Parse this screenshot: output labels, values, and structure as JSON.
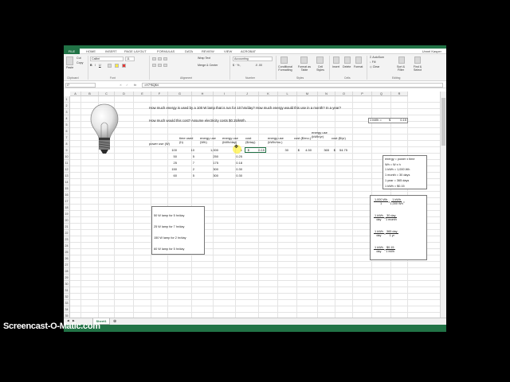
{
  "tabs": {
    "file": "FILE",
    "items": [
      "HOME",
      "INSERT",
      "PAGE LAYOUT",
      "FORMULAS",
      "DATA",
      "REVIEW",
      "VIEW",
      "ACROBAT"
    ],
    "user": "Unnel Kasper"
  },
  "ribbon": {
    "cut": "Cut",
    "copy": "Copy",
    "paste": "Paste",
    "font_name": "Calibri",
    "font_size": "11",
    "wrap_text": "Wrap Text",
    "merge_center": "Merge & Center",
    "number_format": "Accounting",
    "conditional": "Conditional Formatting",
    "format_table": "Format as Table",
    "cell_styles": "Cell Styles",
    "insert": "Insert",
    "delete": "Delete",
    "format": "Format",
    "autosum": "AutoSum",
    "fill": "Fill",
    "clear": "Clear",
    "sort": "Sort & Filter",
    "find": "Find & Select",
    "groups": [
      "Clipboard",
      "Font",
      "Alignment",
      "Number",
      "Styles",
      "Cells",
      "Editing"
    ]
  },
  "formula_bar": {
    "name_box": "I7",
    "fx": "fx",
    "formula": "=H7*$Q$4"
  },
  "columns": [
    "A",
    "B",
    "C",
    "D",
    "E",
    "F",
    "G",
    "H",
    "I",
    "J",
    "K",
    "L",
    "M",
    "N",
    "O",
    "P",
    "Q",
    "R"
  ],
  "rows": [
    "1",
    "2",
    "3",
    "4",
    "5",
    "6",
    "7",
    "8",
    "9",
    "10",
    "11",
    "12",
    "13",
    "14",
    "15",
    "16",
    "17",
    "18",
    "19",
    "20",
    "21",
    "22",
    "23",
    "24",
    "25",
    "26",
    "27",
    "28",
    "29",
    "30",
    "31",
    "32",
    "33",
    "34",
    "35"
  ],
  "sheet": {
    "q1": "How much energy is used by a 100 W lamp that is run for 10 hrs/day?  How much energy would this use in a month?  In a year?",
    "q2": "How much would this cost?   Assume electricity costs $0.15/kWh.",
    "rate_label": "1 kWh =",
    "rate_currency": "$",
    "rate_value": "0.15",
    "headers": {
      "power": "power use (W)",
      "time": "time used (h)",
      "energy_wh": "energy use (Wh)",
      "energy_kwh_day": "energy use (kWh/day)",
      "cost_day": "cost ($/day)",
      "energy_kwh_mo": "energy use (kWh/mo.)",
      "cost_mo": "cost ($/mo.)",
      "energy_kwh_yr": "energy use (kWh/yr)",
      "cost_yr": "cost ($/yr)"
    },
    "table": [
      {
        "power": "100",
        "time": "10",
        "wh": "1,000",
        "kwh": "1",
        "cost_cur": "$",
        "cost": "0.15",
        "kwh_mo": "30",
        "cost_mo_cur": "$",
        "cost_mo": "4.50",
        "kwh_yr": "365",
        "cost_yr_cur": "$",
        "cost_yr": "54.75"
      },
      {
        "power": "50",
        "time": "5",
        "wh": "250",
        "kwh": "0.25",
        "cost_cur": "",
        "cost": "",
        "kwh_mo": "",
        "cost_mo_cur": "",
        "cost_mo": "",
        "kwh_yr": "",
        "cost_yr_cur": "",
        "cost_yr": ""
      },
      {
        "power": "25",
        "time": "7",
        "wh": "175",
        "kwh": "0.18",
        "cost_cur": "",
        "cost": "",
        "kwh_mo": "",
        "cost_mo_cur": "",
        "cost_mo": "",
        "kwh_yr": "",
        "cost_yr_cur": "",
        "cost_yr": ""
      },
      {
        "power": "150",
        "time": "2",
        "wh": "300",
        "kwh": "0.30",
        "cost_cur": "",
        "cost": "",
        "kwh_mo": "",
        "cost_mo_cur": "",
        "cost_mo": "",
        "kwh_yr": "",
        "cost_yr_cur": "",
        "cost_yr": ""
      },
      {
        "power": "60",
        "time": "5",
        "wh": "300",
        "kwh": "0.30",
        "cost_cur": "",
        "cost": "",
        "kwh_mo": "",
        "cost_mo_cur": "",
        "cost_mo": "",
        "kwh_yr": "",
        "cost_yr_cur": "",
        "cost_yr": ""
      }
    ],
    "notes": [
      "energy = power x time",
      "Wh = W x h",
      "1 kWh = 1,000 Wh",
      "1 month = 30 days",
      "1 year = 365 days",
      "1 kWh = $0.15"
    ],
    "lamps": [
      "50 W lamp for 5 hr/day",
      "25 W lamp for 7 hr/day",
      "150 W lamp for 2 hr/day",
      "60 W lamp for 5 hr/day"
    ],
    "conversions": [
      {
        "a_num": "1,000 Wh",
        "a_den": "1",
        "b_num": "1 kWh",
        "b_den": "1,000 Wh",
        "tail": "="
      },
      {
        "a_num": "1 kWh",
        "a_den": "day",
        "b_num": "30 day",
        "b_den": "1 month",
        "tail": ""
      },
      {
        "a_num": "1 kWh",
        "a_den": "day",
        "b_num": "365 day",
        "b_den": "1 yr",
        "tail": ""
      },
      {
        "a_num": "1 kWh",
        "a_den": "day",
        "b_num": "$0.15",
        "b_den": "1 kWh",
        "tail": ""
      }
    ]
  },
  "sheet_tab": "Sheet1",
  "watermark": "Screencast-O-Matic.com"
}
